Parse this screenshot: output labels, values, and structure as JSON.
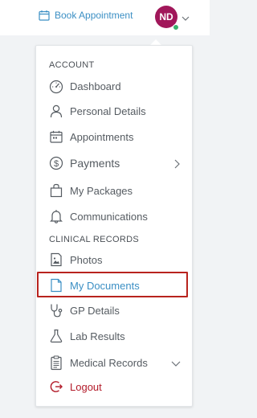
{
  "header": {
    "book_label": "Book Appointment",
    "avatar_initials": "ND",
    "icons": {
      "book": "calendar-icon",
      "chevron": "chevron-down-icon"
    },
    "colors": {
      "link": "#3b8fc4",
      "avatar": "#a1175a",
      "status": "#38b36b"
    }
  },
  "menu": {
    "account_title": "ACCOUNT",
    "clinical_title": "CLINICAL RECORDS",
    "items": [
      {
        "label": "Dashboard",
        "icon": "gauge-icon"
      },
      {
        "label": "Personal Details",
        "icon": "user-icon"
      },
      {
        "label": "Appointments",
        "icon": "calendar-icon"
      },
      {
        "label": "Payments",
        "icon": "dollar-circle-icon",
        "trail": "chevron-right-icon"
      },
      {
        "label": "My Packages",
        "icon": "bag-icon"
      },
      {
        "label": "Communications",
        "icon": "bell-icon"
      },
      {
        "label": "Photos",
        "icon": "photo-icon"
      },
      {
        "label": "My Documents",
        "icon": "document-icon",
        "active": true
      },
      {
        "label": "GP Details",
        "icon": "stethoscope-icon"
      },
      {
        "label": "Lab Results",
        "icon": "flask-icon"
      },
      {
        "label": "Medical Records",
        "icon": "clipboard-icon",
        "trail": "chevron-down-icon"
      },
      {
        "label": "Logout",
        "icon": "logout-icon"
      }
    ],
    "colors": {
      "active": "#3b8fc4",
      "logout": "#b31b2a",
      "highlight_border": "#b8231e"
    }
  }
}
